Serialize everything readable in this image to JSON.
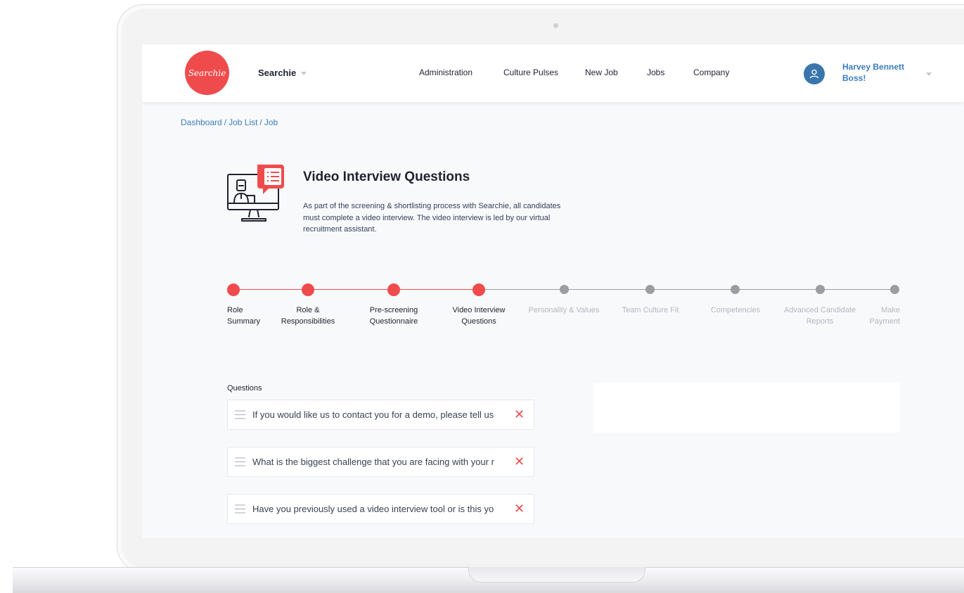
{
  "brand": {
    "logo_text": "Searchie",
    "app_name": "Searchie"
  },
  "nav": {
    "items": [
      "Administration",
      "Culture Pulses",
      "New Job",
      "Jobs",
      "Company"
    ]
  },
  "user": {
    "name": "Harvey Bennett",
    "role": "Boss!"
  },
  "breadcrumb": [
    "Dashboard",
    "Job List",
    "Job"
  ],
  "header": {
    "title": "Video Interview Questions",
    "description": "As part of the screening & shortlisting process with Searchie, all candidates must complete a video interview. The video interview is led by our virtual recruitment assistant."
  },
  "stepper": {
    "current_step": 4,
    "steps": [
      {
        "label_line1": "Role",
        "label_line2": "Summary",
        "status": "done"
      },
      {
        "label_line1": "Role &",
        "label_line2": "Responsibilities",
        "status": "done"
      },
      {
        "label_line1": "Pre-screening",
        "label_line2": "Questionnaire",
        "status": "done"
      },
      {
        "label_line1": "Video Interview",
        "label_line2": "Questions",
        "status": "current"
      },
      {
        "label_line1": "Personality & Values",
        "label_line2": "",
        "status": "todo"
      },
      {
        "label_line1": "Team Culture Fit",
        "label_line2": "",
        "status": "todo"
      },
      {
        "label_line1": "Competencies",
        "label_line2": "",
        "status": "todo"
      },
      {
        "label_line1": "Advanced Candidate",
        "label_line2": "Reports",
        "status": "todo"
      },
      {
        "label_line1": "Make",
        "label_line2": "Payment",
        "status": "todo"
      }
    ]
  },
  "questions": {
    "heading": "Questions",
    "items": [
      "If you would like us to contact you for a demo, please tell us",
      "What is the biggest challenge that you are facing with your r",
      "Have you previously used a video interview tool or is this yo"
    ],
    "delete_symbol": "✕"
  },
  "colors": {
    "accent": "#f04b4c",
    "link": "#3c7dbd",
    "inactive": "#9b9da3",
    "background": "#f8f9fb"
  },
  "icons": [
    "chevron-down-icon",
    "user-icon",
    "drag-handle-icon",
    "close-icon",
    "video-interview-illustration"
  ]
}
